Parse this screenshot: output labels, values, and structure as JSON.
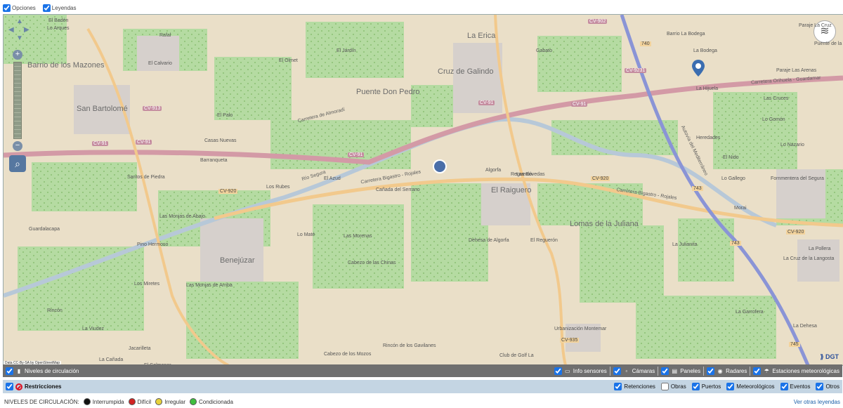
{
  "top_options": {
    "opciones": "Opciones",
    "leyendas": "Leyendas"
  },
  "map": {
    "places": [
      "El Badén",
      "Lo Arques",
      "Rafal",
      "Barrio de los Mazones",
      "El Calvario",
      "San Bartolomé",
      "La Erica",
      "Cruz de Galindo",
      "Puente Don Pedro",
      "El Olmet",
      "El Jardín",
      "Gabato",
      "Barrio La Bodega",
      "Paraje La Cruz",
      "Puente de la",
      "La Bodega",
      "Paraje Las Arenas",
      "La Hijuela",
      "Las Cruces",
      "Heredades",
      "Lo Gomón",
      "Lo Nazario",
      "El Nido",
      "Fornmentera del Segura",
      "Lo Gallego",
      "Casas Nuevas",
      "El Palo",
      "Barranqueta",
      "Santos de Piedra",
      "Los Rubes",
      "El Azud",
      "Cañada del Serrano",
      "Algorfa",
      "Reguerón",
      "Las Bóvedas",
      "El Raiguero",
      "Las Monjas de Abajo",
      "Guardalacapa",
      "Pino Hermoso",
      "Benejúzar",
      "Lo Maté",
      "Las Morenas",
      "Cabezo de las Chinas",
      "Dehesa de Algorfa",
      "El Reguerón",
      "Lomas de la Juliana",
      "La Julianita",
      "Morai",
      "La Pollera",
      "La Cruz de la Langosta",
      "Los Miretes",
      "Las Monjas de Arriba",
      "Rincón",
      "La Viudez",
      "Jacarilleta",
      "La Cañada",
      "El Colmenar",
      "Cabezo de los Mozos",
      "Rincón de los Gavilanes",
      "Club de Golf La",
      "Urbanización Montemar",
      "La Garrofera",
      "La Dehesa"
    ],
    "roads": [
      "CV-91",
      "CV-91",
      "CV-91",
      "CV-91",
      "CV-913",
      "CV-902",
      "CV-9231",
      "CV-920",
      "CV-920",
      "CV-920",
      "CV-935",
      "CV-91",
      "740",
      "743",
      "743",
      "745"
    ],
    "road_names": [
      "Carretera de Almoradí",
      "Carretera Bigastro - Rojales",
      "Carretera Bigastro - Rojales",
      "Carretera Orihuela - Guardamar",
      "Río Segura",
      "Autovía del Mediterráneo"
    ],
    "copyright": "Data CC-By-SA by OpenStreetMap",
    "dgt_label": "DGT",
    "accent": "#5677a0"
  },
  "bar1": {
    "niveles": "Niveles de circulación",
    "info_sensores": "Info sensores",
    "camaras": "Cámaras",
    "paneles": "Paneles",
    "radares": "Radares",
    "estaciones": "Estaciones meteorológicas"
  },
  "bar2": {
    "restricciones": "Restricciones",
    "retenciones": "Retenciones",
    "obras": "Obras",
    "puertos": "Puertos",
    "meteorologicos": "Meteorológicos",
    "eventos": "Eventos",
    "otros": "Otros"
  },
  "legend": {
    "title": "NIVELES DE CIRCULACIÓN:",
    "items": [
      {
        "label": "Interrumpida",
        "color": "#111111"
      },
      {
        "label": "Difícil",
        "color": "#d22222"
      },
      {
        "label": "Irregular",
        "color": "#e8d23a"
      },
      {
        "label": "Condicionada",
        "color": "#3fbf3f"
      }
    ],
    "link": "Ver otras leyendas"
  }
}
